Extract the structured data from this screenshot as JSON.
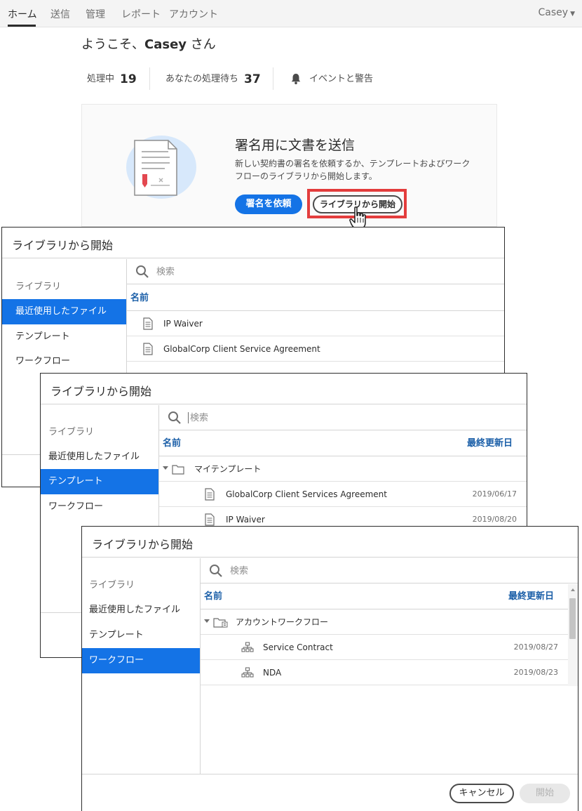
{
  "nav": {
    "tabs": [
      "ホーム",
      "送信",
      "管理",
      "レポート",
      "アカウント"
    ],
    "user": "Casey"
  },
  "home": {
    "welcome_prefix": "ようこそ、",
    "welcome_name": "Casey",
    "welcome_suffix": " さん",
    "stats": {
      "in_progress_label": "処理中",
      "in_progress_count": "19",
      "waiting_label": "あなたの処理待ち",
      "waiting_count": "37",
      "events_label": "イベントと警告"
    },
    "card": {
      "title": "署名用に文書を送信",
      "description": "新しい契約書の署名を依頼するか、テンプレートおよびワークフローのライブラリから開始します。",
      "request_button": "署名を依頼",
      "library_button": "ライブラリから開始"
    }
  },
  "dialog_recent": {
    "title": "ライブラリから開始",
    "sidebar": [
      "ライブラリ",
      "最近使用したファイル",
      "テンプレート",
      "ワークフロー"
    ],
    "search_placeholder": "検索",
    "col_name": "名前",
    "rows": [
      "IP Waiver",
      "GlobalCorp Client Service Agreement"
    ]
  },
  "dialog_templates": {
    "title": "ライブラリから開始",
    "sidebar": [
      "ライブラリ",
      "最近使用したファイル",
      "テンプレート",
      "ワークフロー"
    ],
    "search_placeholder": "検索",
    "col_name": "名前",
    "col_date": "最終更新日",
    "folder": "マイテンプレート",
    "rows": [
      {
        "name": "GlobalCorp Client Services Agreement",
        "date": "2019/06/17"
      },
      {
        "name": "IP Waiver",
        "date": "2019/08/20"
      }
    ]
  },
  "dialog_workflows": {
    "title": "ライブラリから開始",
    "sidebar": [
      "ライブラリ",
      "最近使用したファイル",
      "テンプレート",
      "ワークフロー"
    ],
    "search_placeholder": "検索",
    "col_name": "名前",
    "col_date": "最終更新日",
    "folder": "アカウントワークフロー",
    "rows": [
      {
        "name": "Service Contract",
        "date": "2019/08/27"
      },
      {
        "name": "NDA",
        "date": "2019/08/23"
      }
    ],
    "cancel_button": "キャンセル",
    "start_button": "開始"
  },
  "colors": {
    "accent": "#1473e6",
    "highlight": "#e33d3d",
    "header_text": "#1b5fa8"
  }
}
